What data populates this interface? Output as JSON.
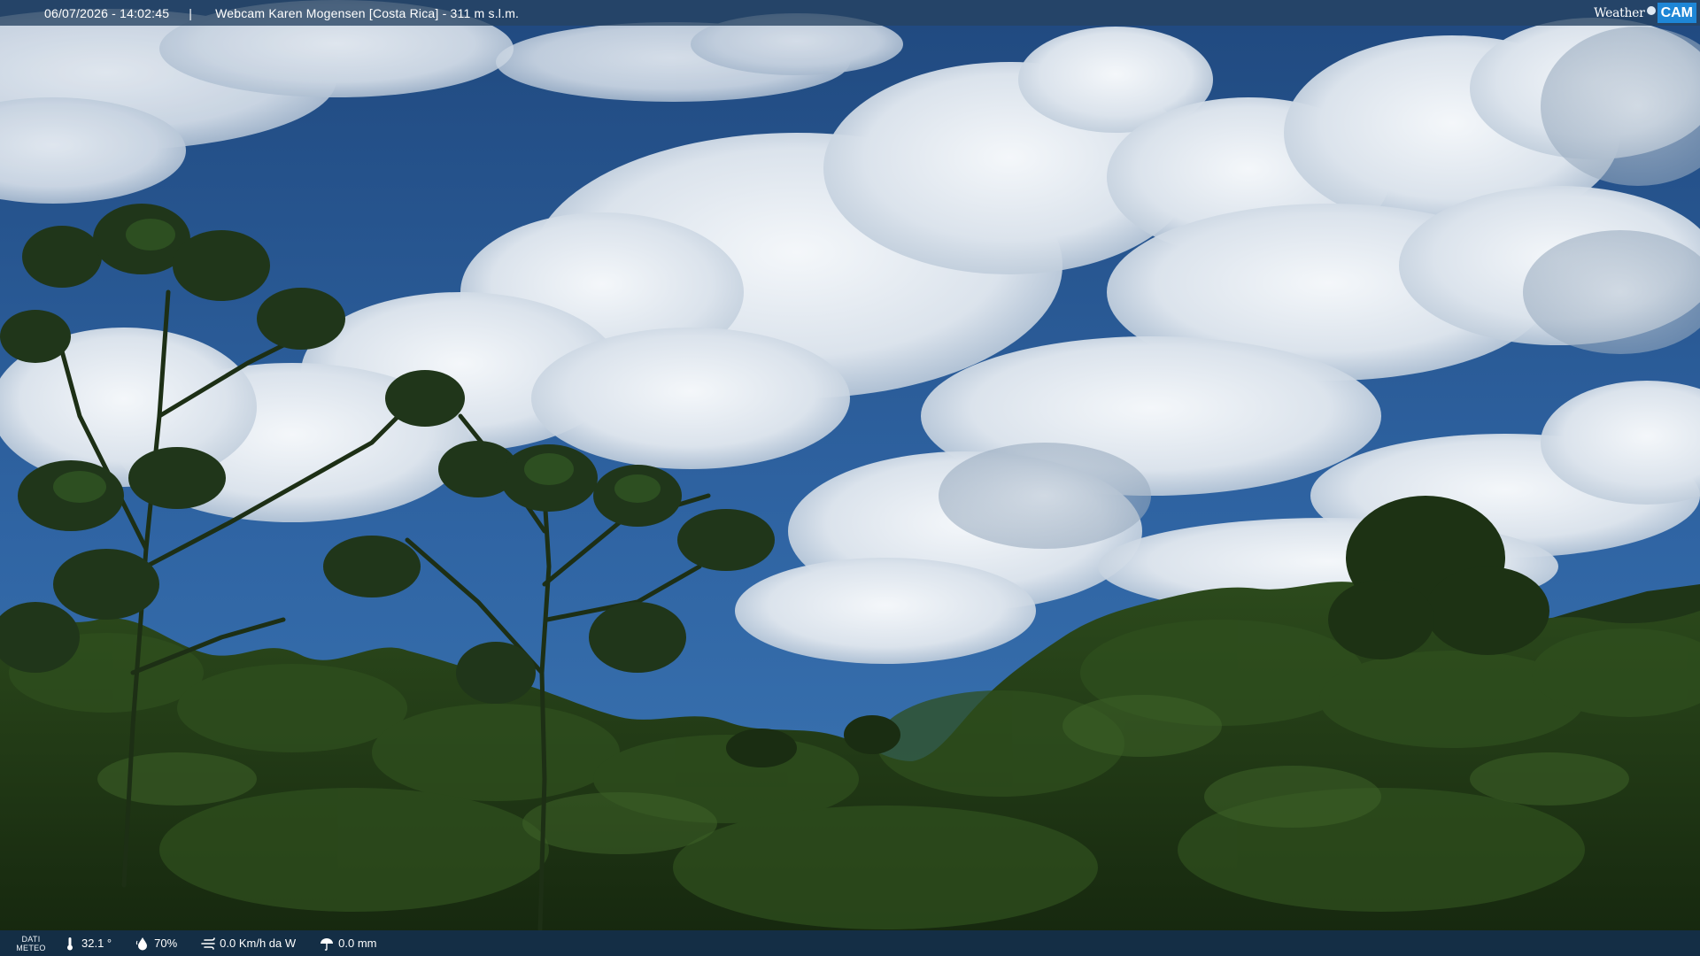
{
  "header": {
    "datetime": "06/07/2026 - 14:02:45",
    "separator": "|",
    "title": "Webcam Karen Mogensen [Costa Rica]  - 311 m s.l.m."
  },
  "logo": {
    "weather": "Weather",
    "cam": "CAM"
  },
  "footer": {
    "label_line1": "DATI",
    "label_line2": "METEO",
    "temperature": "32.1 °",
    "humidity": "70%",
    "wind": "0.0 Km/h da W",
    "rain": "0.0 mm"
  },
  "icons": {
    "temperature": "thermometer-icon",
    "humidity": "humidity-drop-icon",
    "wind": "wind-icon",
    "rain": "rain-umbrella-icon"
  },
  "colors": {
    "sky_top": "#244f86",
    "sky_bottom": "#3a74b3",
    "cloud": "#e9eef3",
    "foliage_dark": "#16270f",
    "foliage_mid": "#2a4519",
    "logo_accent": "#1e86d6"
  }
}
